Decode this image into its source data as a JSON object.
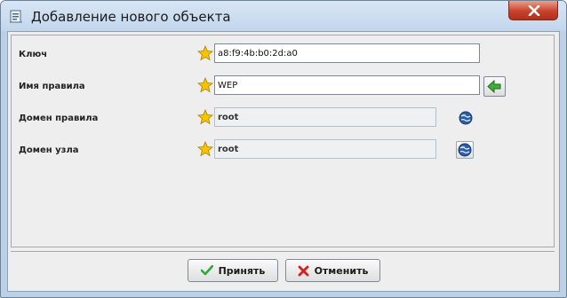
{
  "window": {
    "title": "Добавление нового объекта"
  },
  "form": {
    "key": {
      "label": "Ключ",
      "value": "a8:f9:4b:b0:2d:a0"
    },
    "rule_name": {
      "label": "Имя правила",
      "value": "WEP"
    },
    "rule_domain": {
      "label": "Домен правила",
      "value": "root"
    },
    "node_domain": {
      "label": "Домен узла",
      "value": "root"
    }
  },
  "buttons": {
    "accept": "Принять",
    "cancel": "Отменить"
  },
  "icons": {
    "star": "required-star-icon",
    "arrow": "green-left-arrow-icon",
    "globe": "globe-icon",
    "check": "green-check-icon",
    "cross": "red-x-icon",
    "close": "close-icon"
  },
  "colors": {
    "close_button": "#c8422c",
    "star": "#f5c400",
    "check": "#2faa3a",
    "cross": "#d62020"
  }
}
